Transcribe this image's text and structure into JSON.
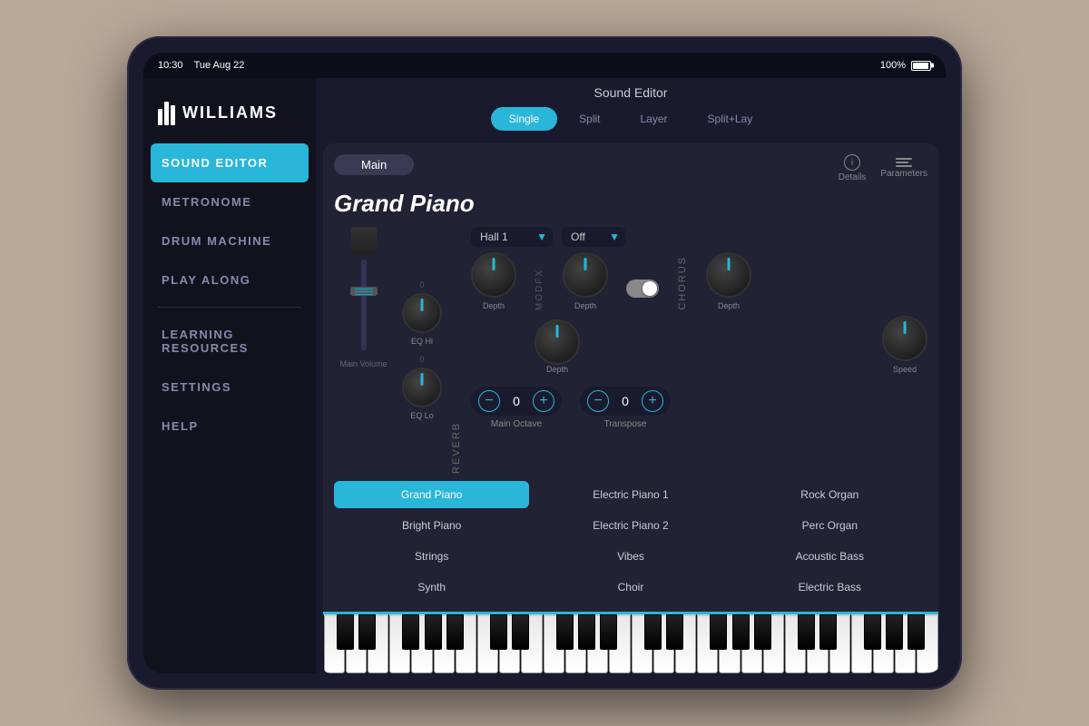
{
  "statusBar": {
    "time": "10:30",
    "date": "Tue Aug 22",
    "battery": "100%"
  },
  "sidebar": {
    "logo": "WILLIAMS",
    "items": [
      {
        "id": "sound-editor",
        "label": "Sound Editor",
        "active": true
      },
      {
        "id": "metronome",
        "label": "Metronome",
        "active": false
      },
      {
        "id": "drum-machine",
        "label": "Drum Machine",
        "active": false
      },
      {
        "id": "play-along",
        "label": "Play Along",
        "active": false
      },
      {
        "id": "learning-resources",
        "label": "Learning Resources",
        "active": false
      },
      {
        "id": "settings",
        "label": "Settings",
        "active": false
      },
      {
        "id": "help",
        "label": "Help",
        "active": false
      }
    ]
  },
  "editor": {
    "title": "Sound Editor",
    "tabs": [
      {
        "id": "single",
        "label": "Single",
        "active": true
      },
      {
        "id": "split",
        "label": "Split",
        "active": false
      },
      {
        "id": "layer",
        "label": "Layer",
        "active": false
      },
      {
        "id": "splitlay",
        "label": "Split+Lay",
        "active": false
      }
    ],
    "contentTab": "Main",
    "instrumentName": "Grand Piano",
    "detailsLabel": "Details",
    "parametersLabel": "Parameters",
    "reverb": {
      "label": "Reverb",
      "preset": "Hall 1",
      "onOff": "Off"
    },
    "chorus": {
      "label": "Chorus",
      "onOff": "Off"
    },
    "modfx": {
      "label": "ModFX"
    },
    "eq": {
      "hiLabel": "EQ Hi",
      "loLabel": "EQ Lo"
    },
    "controls": {
      "octave": {
        "label": "Main Octave",
        "value": "0"
      },
      "transpose": {
        "label": "Transpose",
        "value": "0"
      }
    },
    "volumeLabel": "Main Volume",
    "sounds": [
      {
        "id": "grand-piano",
        "label": "Grand Piano",
        "active": true
      },
      {
        "id": "electric-piano-1",
        "label": "Electric Piano 1",
        "active": false
      },
      {
        "id": "rock-organ",
        "label": "Rock Organ",
        "active": false
      },
      {
        "id": "bright-piano",
        "label": "Bright Piano",
        "active": false
      },
      {
        "id": "electric-piano-2",
        "label": "Electric Piano 2",
        "active": false
      },
      {
        "id": "perc-organ",
        "label": "Perc Organ",
        "active": false
      },
      {
        "id": "strings",
        "label": "Strings",
        "active": false
      },
      {
        "id": "vibes",
        "label": "Vibes",
        "active": false
      },
      {
        "id": "acoustic-bass",
        "label": "Acoustic Bass",
        "active": false
      },
      {
        "id": "synth",
        "label": "Synth",
        "active": false
      },
      {
        "id": "choir",
        "label": "Choir",
        "active": false
      },
      {
        "id": "electric-bass",
        "label": "Electric Bass",
        "active": false
      }
    ]
  }
}
